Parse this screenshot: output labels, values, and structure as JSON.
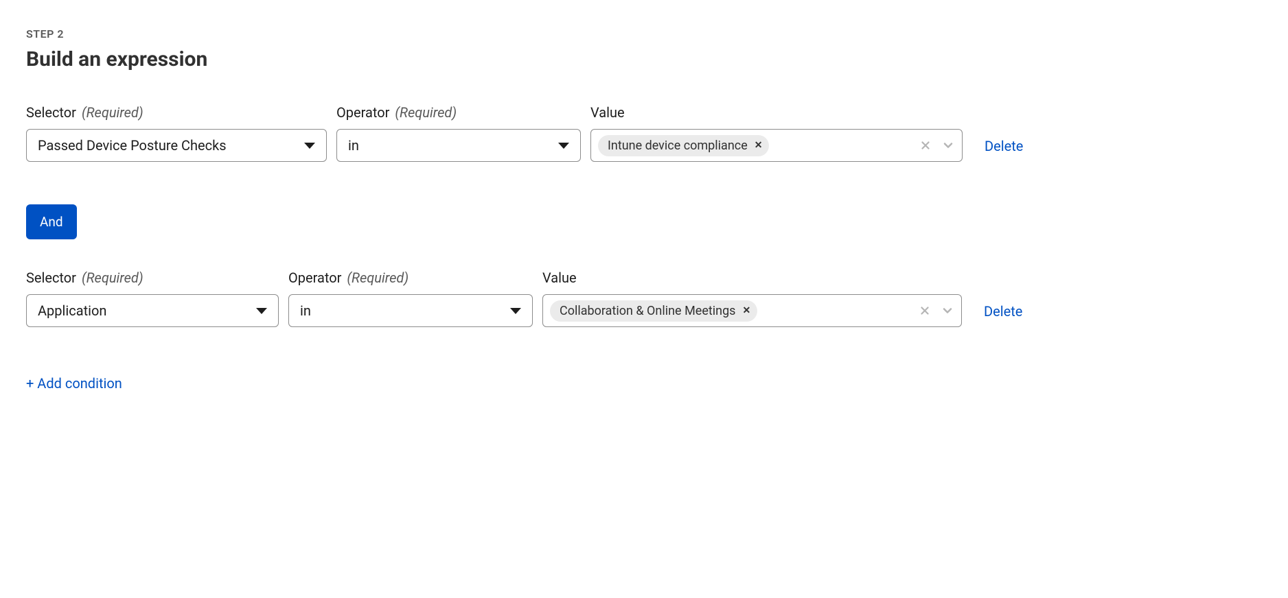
{
  "step_label": "STEP 2",
  "page_title": "Build an expression",
  "labels": {
    "selector": "Selector",
    "operator": "Operator",
    "value": "Value",
    "required": "(Required)"
  },
  "rows": [
    {
      "selector": "Passed Device Posture Checks",
      "operator": "in",
      "tag": "Intune device compliance",
      "delete": "Delete"
    },
    {
      "selector": "Application",
      "operator": "in",
      "tag": "Collaboration & Online Meetings",
      "delete": "Delete"
    }
  ],
  "logic_operator": "And",
  "add_condition": "+ Add condition"
}
